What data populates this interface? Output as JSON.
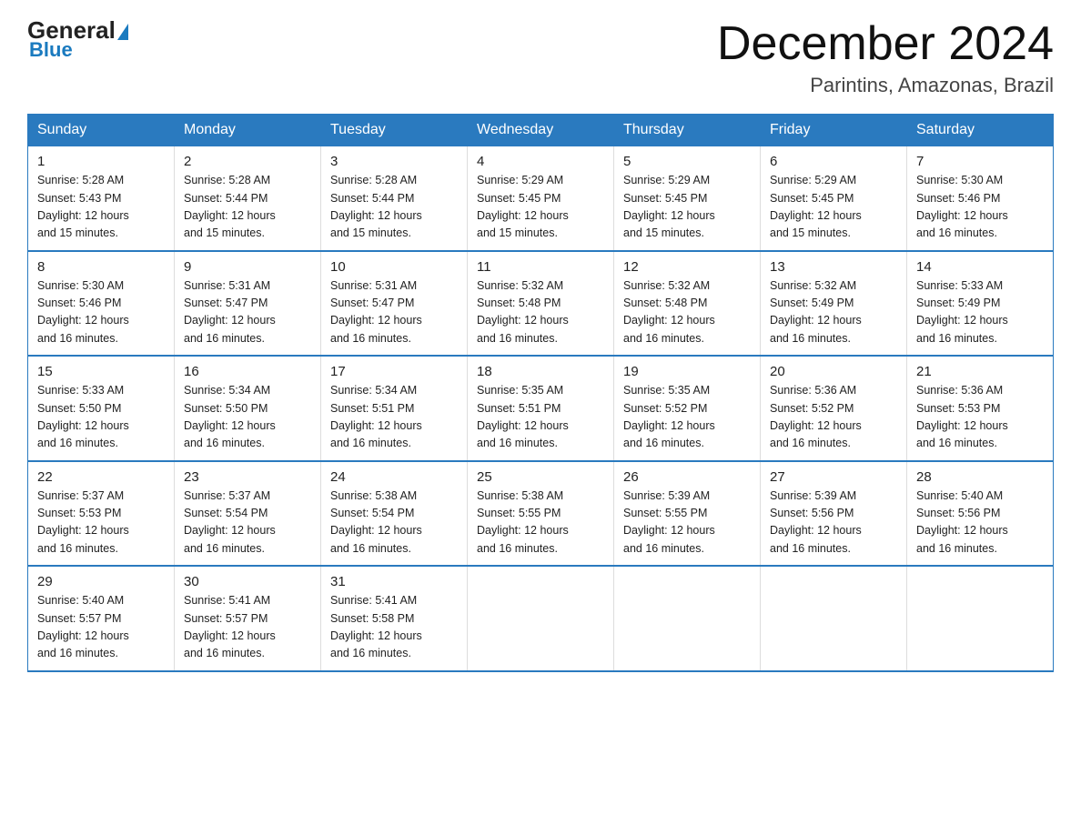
{
  "logo": {
    "general": "General",
    "triangle": "",
    "blue": "Blue"
  },
  "title": "December 2024",
  "location": "Parintins, Amazonas, Brazil",
  "days_of_week": [
    "Sunday",
    "Monday",
    "Tuesday",
    "Wednesday",
    "Thursday",
    "Friday",
    "Saturday"
  ],
  "weeks": [
    [
      {
        "day": "1",
        "sunrise": "5:28 AM",
        "sunset": "5:43 PM",
        "daylight": "12 hours and 15 minutes."
      },
      {
        "day": "2",
        "sunrise": "5:28 AM",
        "sunset": "5:44 PM",
        "daylight": "12 hours and 15 minutes."
      },
      {
        "day": "3",
        "sunrise": "5:28 AM",
        "sunset": "5:44 PM",
        "daylight": "12 hours and 15 minutes."
      },
      {
        "day": "4",
        "sunrise": "5:29 AM",
        "sunset": "5:45 PM",
        "daylight": "12 hours and 15 minutes."
      },
      {
        "day": "5",
        "sunrise": "5:29 AM",
        "sunset": "5:45 PM",
        "daylight": "12 hours and 15 minutes."
      },
      {
        "day": "6",
        "sunrise": "5:29 AM",
        "sunset": "5:45 PM",
        "daylight": "12 hours and 15 minutes."
      },
      {
        "day": "7",
        "sunrise": "5:30 AM",
        "sunset": "5:46 PM",
        "daylight": "12 hours and 16 minutes."
      }
    ],
    [
      {
        "day": "8",
        "sunrise": "5:30 AM",
        "sunset": "5:46 PM",
        "daylight": "12 hours and 16 minutes."
      },
      {
        "day": "9",
        "sunrise": "5:31 AM",
        "sunset": "5:47 PM",
        "daylight": "12 hours and 16 minutes."
      },
      {
        "day": "10",
        "sunrise": "5:31 AM",
        "sunset": "5:47 PM",
        "daylight": "12 hours and 16 minutes."
      },
      {
        "day": "11",
        "sunrise": "5:32 AM",
        "sunset": "5:48 PM",
        "daylight": "12 hours and 16 minutes."
      },
      {
        "day": "12",
        "sunrise": "5:32 AM",
        "sunset": "5:48 PM",
        "daylight": "12 hours and 16 minutes."
      },
      {
        "day": "13",
        "sunrise": "5:32 AM",
        "sunset": "5:49 PM",
        "daylight": "12 hours and 16 minutes."
      },
      {
        "day": "14",
        "sunrise": "5:33 AM",
        "sunset": "5:49 PM",
        "daylight": "12 hours and 16 minutes."
      }
    ],
    [
      {
        "day": "15",
        "sunrise": "5:33 AM",
        "sunset": "5:50 PM",
        "daylight": "12 hours and 16 minutes."
      },
      {
        "day": "16",
        "sunrise": "5:34 AM",
        "sunset": "5:50 PM",
        "daylight": "12 hours and 16 minutes."
      },
      {
        "day": "17",
        "sunrise": "5:34 AM",
        "sunset": "5:51 PM",
        "daylight": "12 hours and 16 minutes."
      },
      {
        "day": "18",
        "sunrise": "5:35 AM",
        "sunset": "5:51 PM",
        "daylight": "12 hours and 16 minutes."
      },
      {
        "day": "19",
        "sunrise": "5:35 AM",
        "sunset": "5:52 PM",
        "daylight": "12 hours and 16 minutes."
      },
      {
        "day": "20",
        "sunrise": "5:36 AM",
        "sunset": "5:52 PM",
        "daylight": "12 hours and 16 minutes."
      },
      {
        "day": "21",
        "sunrise": "5:36 AM",
        "sunset": "5:53 PM",
        "daylight": "12 hours and 16 minutes."
      }
    ],
    [
      {
        "day": "22",
        "sunrise": "5:37 AM",
        "sunset": "5:53 PM",
        "daylight": "12 hours and 16 minutes."
      },
      {
        "day": "23",
        "sunrise": "5:37 AM",
        "sunset": "5:54 PM",
        "daylight": "12 hours and 16 minutes."
      },
      {
        "day": "24",
        "sunrise": "5:38 AM",
        "sunset": "5:54 PM",
        "daylight": "12 hours and 16 minutes."
      },
      {
        "day": "25",
        "sunrise": "5:38 AM",
        "sunset": "5:55 PM",
        "daylight": "12 hours and 16 minutes."
      },
      {
        "day": "26",
        "sunrise": "5:39 AM",
        "sunset": "5:55 PM",
        "daylight": "12 hours and 16 minutes."
      },
      {
        "day": "27",
        "sunrise": "5:39 AM",
        "sunset": "5:56 PM",
        "daylight": "12 hours and 16 minutes."
      },
      {
        "day": "28",
        "sunrise": "5:40 AM",
        "sunset": "5:56 PM",
        "daylight": "12 hours and 16 minutes."
      }
    ],
    [
      {
        "day": "29",
        "sunrise": "5:40 AM",
        "sunset": "5:57 PM",
        "daylight": "12 hours and 16 minutes."
      },
      {
        "day": "30",
        "sunrise": "5:41 AM",
        "sunset": "5:57 PM",
        "daylight": "12 hours and 16 minutes."
      },
      {
        "day": "31",
        "sunrise": "5:41 AM",
        "sunset": "5:58 PM",
        "daylight": "12 hours and 16 minutes."
      },
      null,
      null,
      null,
      null
    ]
  ],
  "labels": {
    "sunrise": "Sunrise:",
    "sunset": "Sunset:",
    "daylight": "Daylight:"
  }
}
